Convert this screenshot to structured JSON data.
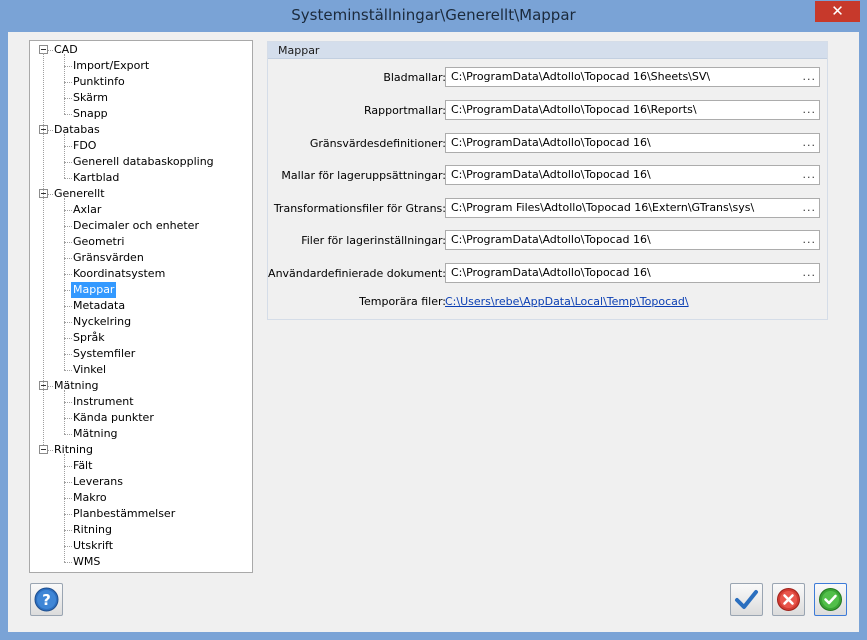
{
  "window": {
    "title": "Systeminställningar\\Generellt\\Mappar",
    "close_label": "✕"
  },
  "tree": {
    "groups": [
      {
        "label": "CAD",
        "items": [
          "Import/Export",
          "Punktinfo",
          "Skärm",
          "Snapp"
        ]
      },
      {
        "label": "Databas",
        "items": [
          "FDO",
          "Generell databaskoppling",
          "Kartblad"
        ]
      },
      {
        "label": "Generellt",
        "items": [
          "Axlar",
          "Decimaler och enheter",
          "Geometri",
          "Gränsvärden",
          "Koordinatsystem",
          "Mappar",
          "Metadata",
          "Nyckelring",
          "Språk",
          "Systemfiler",
          "Vinkel"
        ]
      },
      {
        "label": "Mätning",
        "items": [
          "Instrument",
          "Kända punkter",
          "Mätning"
        ]
      },
      {
        "label": "Ritning",
        "items": [
          "Fält",
          "Leverans",
          "Makro",
          "Planbestämmelser",
          "Ritning",
          "Utskrift",
          "WMS"
        ]
      }
    ],
    "selected": "Mappar"
  },
  "panel": {
    "header": "Mappar",
    "browse_label": "...",
    "rows": [
      {
        "label": "Bladmallar:",
        "value": "C:\\ProgramData\\Adtollo\\Topocad 16\\Sheets\\SV\\"
      },
      {
        "label": "Rapportmallar:",
        "value": "C:\\ProgramData\\Adtollo\\Topocad 16\\Reports\\"
      },
      {
        "label": "Gränsvärdesdefinitioner:",
        "value": "C:\\ProgramData\\Adtollo\\Topocad 16\\"
      },
      {
        "label": "Mallar för lageruppsättningar:",
        "value": "C:\\ProgramData\\Adtollo\\Topocad 16\\"
      },
      {
        "label": "Transformationsfiler för Gtrans:",
        "value": "C:\\Program Files\\Adtollo\\Topocad 16\\Extern\\GTrans\\sys\\"
      },
      {
        "label": "Filer för lagerinställningar:",
        "value": "C:\\ProgramData\\Adtollo\\Topocad 16\\"
      },
      {
        "label": "Användardefinierade dokument:",
        "value": "C:\\ProgramData\\Adtollo\\Topocad 16\\"
      }
    ],
    "temp": {
      "label": "Temporära filer:",
      "value": "C:\\Users\\rebe\\AppData\\Local\\Temp\\Topocad\\"
    }
  },
  "buttons": {
    "help": "help-icon",
    "apply": "check-icon",
    "cancel": "cancel-icon",
    "ok": "ok-icon"
  },
  "colors": {
    "title_bar": "#7aa3d6",
    "close": "#c7392b",
    "selection": "#3399ff",
    "link": "#0b3fb3"
  }
}
